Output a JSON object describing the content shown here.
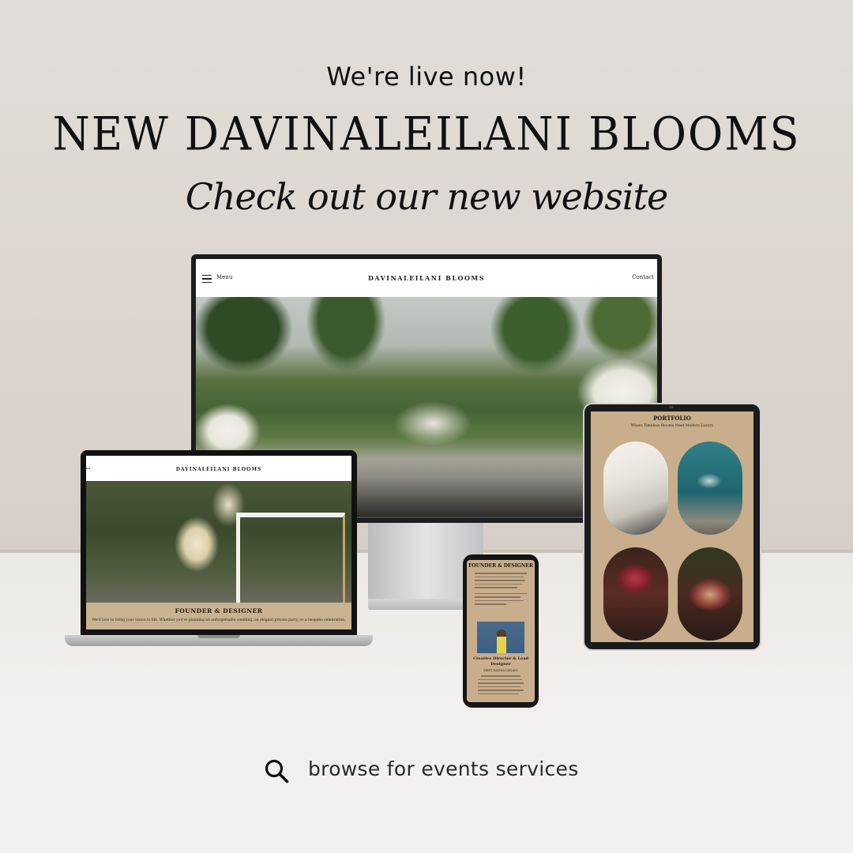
{
  "header": {
    "eyebrow": "We're live now!",
    "brand": "NEW DAVINALEILANI BLOOMS",
    "script_line": "Check out our new website"
  },
  "monitor": {
    "nav_menu": "Menu",
    "nav_title": "DAVINALEILANI BLOOMS",
    "nav_contact": "Contact"
  },
  "laptop": {
    "nav_menu": "nu",
    "nav_title": "DAVINALEILANI BLOOMS",
    "section_title": "FOUNDER & DESIGNER",
    "section_text": "We'd love to bring your vision to life. Whether you're planning an unforgettable wedding, an elegant private party, or a bespoke celebration,"
  },
  "tablet": {
    "title": "PORTFOLIO",
    "subtitle": "Where Timeless Blooms Meet Modern Luxury"
  },
  "phone": {
    "title": "FOUNDER & DESIGNER",
    "role": "Creative Director & Lead Designer",
    "name": "MEET DAVINA LEILANI"
  },
  "search": {
    "label": "browse for events services",
    "icon": "search-icon"
  },
  "colors": {
    "background": "#ddd7d1",
    "accent_band": "#c9b290",
    "text": "#111111"
  }
}
